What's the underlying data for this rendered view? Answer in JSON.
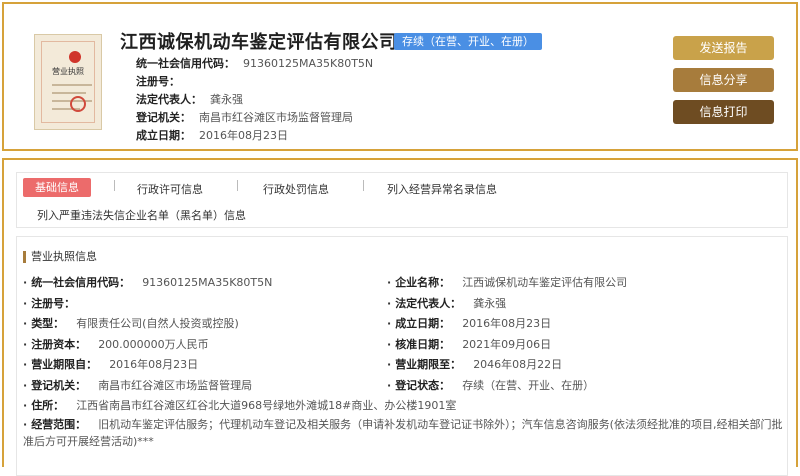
{
  "header": {
    "company_name": "江西诚保机动车鉴定评估有限公司",
    "status": "存续（在营、开业、在册）",
    "license_caption": "营业执照",
    "rows": [
      {
        "label": "统一社会信用代码：",
        "value": "91360125MA35K80T5N"
      },
      {
        "label": "注册号：",
        "value": ""
      },
      {
        "label": "法定代表人：",
        "value": "龚永强"
      },
      {
        "label": "登记机关：",
        "value": "南昌市红谷滩区市场监督管理局"
      },
      {
        "label": "成立日期：",
        "value": "2016年08月23日"
      }
    ],
    "buttons": {
      "send": "发送报告",
      "share": "信息分享",
      "print": "信息打印"
    }
  },
  "tabs": [
    "基础信息",
    "行政许可信息",
    "行政处罚信息",
    "列入经营异常名录信息",
    "列入严重违法失信企业名单（黑名单）信息"
  ],
  "section_title": "营业执照信息",
  "fields_left": [
    {
      "label": "统一社会信用代码：",
      "value": "91360125MA35K80T5N"
    },
    {
      "label": "注册号：",
      "value": ""
    },
    {
      "label": "类型：",
      "value": "有限责任公司(自然人投资或控股)"
    },
    {
      "label": "注册资本：",
      "value": "200.000000万人民币"
    },
    {
      "label": "营业期限自：",
      "value": "2016年08月23日"
    },
    {
      "label": "登记机关：",
      "value": "南昌市红谷滩区市场监督管理局"
    }
  ],
  "fields_right": [
    {
      "label": "企业名称：",
      "value": "江西诚保机动车鉴定评估有限公司"
    },
    {
      "label": "法定代表人：",
      "value": "龚永强"
    },
    {
      "label": "成立日期：",
      "value": "2016年08月23日"
    },
    {
      "label": "核准日期：",
      "value": "2021年09月06日"
    },
    {
      "label": "营业期限至：",
      "value": "2046年08月22日"
    },
    {
      "label": "登记状态：",
      "value": "存续（在营、开业、在册）"
    }
  ],
  "address": {
    "label": "住所：",
    "value": "江西省南昌市红谷滩区红谷北大道968号绿地外滩城18#商业、办公楼1901室"
  },
  "scope": {
    "label": "经营范围：",
    "value": "旧机动车鉴定评估服务；代理机动车登记及相关服务（申请补发机动车登记证书除外）；汽车信息咨询服务(依法须经批准的项目,经相关部门批准后方可开展经营活动)***"
  }
}
